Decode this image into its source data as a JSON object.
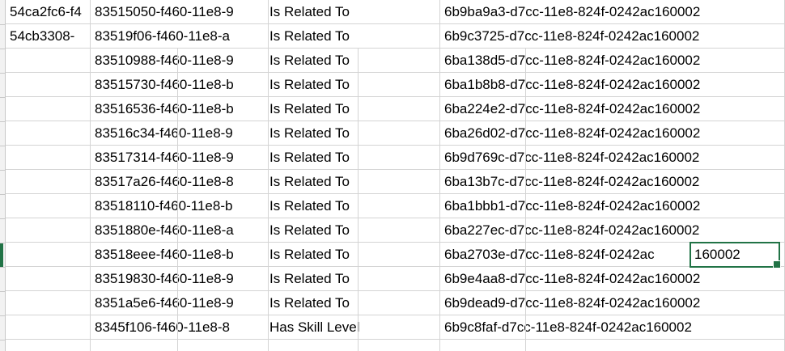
{
  "sheet": {
    "accent_color": "#217346",
    "selected_cell_text": "160002",
    "rows": [
      {
        "a": "54ca2fc6-f4",
        "b": "83515050-f460-11e8-9",
        "c": "Is Related To",
        "d": "6b9ba9a3-d7cc-11e8-824f-0242ac160002"
      },
      {
        "a": "54cb3308-",
        "b": "83519f06-f460-11e8-a",
        "c": "Is Related To",
        "d": "6b9c3725-d7cc-11e8-824f-0242ac160002"
      },
      {
        "a": "",
        "b": "83510988-f460-11e8-9",
        "c": "Is Related To",
        "d": "6ba138d5-d7cc-11e8-824f-0242ac160002"
      },
      {
        "a": "",
        "b": "83515730-f460-11e8-b",
        "c": "Is Related To",
        "d": "6ba1b8b8-d7cc-11e8-824f-0242ac160002"
      },
      {
        "a": "",
        "b": "83516536-f460-11e8-b",
        "c": "Is Related To",
        "d": "6ba224e2-d7cc-11e8-824f-0242ac160002"
      },
      {
        "a": "",
        "b": "83516c34-f460-11e8-9",
        "c": "Is Related To",
        "d": "6ba26d02-d7cc-11e8-824f-0242ac160002"
      },
      {
        "a": "",
        "b": "83517314-f460-11e8-9",
        "c": "Is Related To",
        "d": "6b9d769c-d7cc-11e8-824f-0242ac160002"
      },
      {
        "a": "",
        "b": "83517a26-f460-11e8-8",
        "c": "Is Related To",
        "d": "6ba13b7c-d7cc-11e8-824f-0242ac160002"
      },
      {
        "a": "",
        "b": "83518110-f460-11e8-b",
        "c": "Is Related To",
        "d": "6ba1bbb1-d7cc-11e8-824f-0242ac160002"
      },
      {
        "a": "",
        "b": "8351880e-f460-11e8-a",
        "c": "Is Related To",
        "d": "6ba227ec-d7cc-11e8-824f-0242ac160002"
      },
      {
        "a": "",
        "b": "83518eee-f460-11e8-b",
        "c": "Is Related To",
        "d": "6ba2703e-d7cc-11e8-824f-0242ac"
      },
      {
        "a": "",
        "b": "83519830-f460-11e8-9",
        "c": "Is Related To",
        "d": "6b9e4aa8-d7cc-11e8-824f-0242ac160002"
      },
      {
        "a": "",
        "b": "8351a5e6-f460-11e8-9",
        "c": "Is Related To",
        "d": "6b9dead9-d7cc-11e8-824f-0242ac160002"
      },
      {
        "a": "",
        "b": "8345f106-f460-11e8-8",
        "c": "Has Skill Level",
        "d": "6b9c8faf-d7cc-11e8-824f-0242ac160002"
      },
      {
        "a": "",
        "b": "",
        "c": "",
        "d": ""
      }
    ]
  }
}
